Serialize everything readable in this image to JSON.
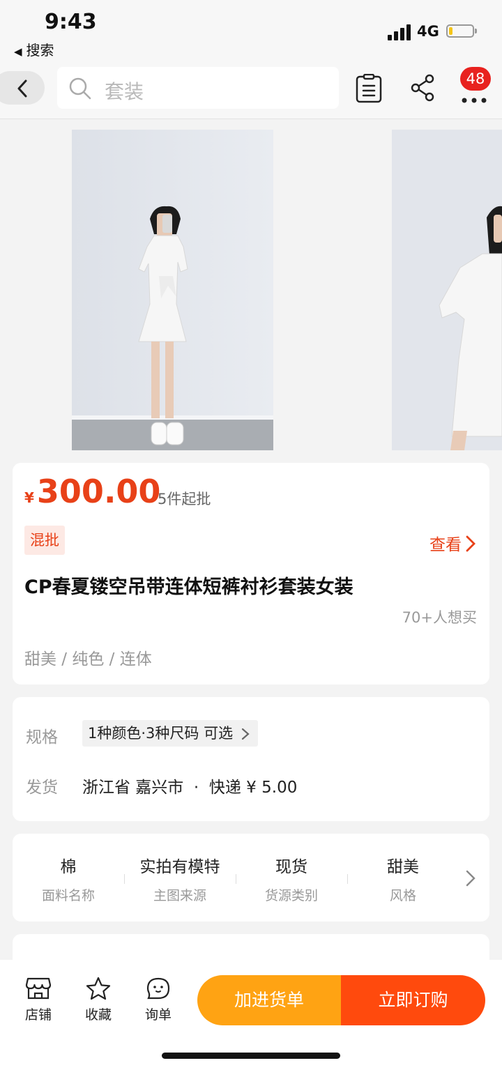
{
  "status_bar": {
    "time": "9:43",
    "back_app": "搜索",
    "network": "4G"
  },
  "nav": {
    "search_placeholder": "套装",
    "cart_count": "48"
  },
  "product": {
    "price_symbol": "¥",
    "price": "300.00",
    "moq": "5件起批",
    "tag": "混批",
    "view_more": "查看",
    "title": "CP春夏镂空吊带连体短裤衬衫套装女装",
    "want_count": "70+人想买",
    "attributes": "甜美 / 纯色 / 连体"
  },
  "spec": {
    "label": "规格",
    "value": "1种颜色·3种尺码 可选",
    "ship_label": "发货",
    "ship_value": "浙江省 嘉兴市  ·  快递 ¥ 5.00"
  },
  "params": [
    {
      "value": "棉",
      "key": "面料名称"
    },
    {
      "value": "实拍有模特",
      "key": "主图来源"
    },
    {
      "value": "现货",
      "key": "货源类别"
    },
    {
      "value": "甜美",
      "key": "风格"
    }
  ],
  "bottom_bar": {
    "shop": "店铺",
    "favorite": "收藏",
    "inquiry": "询单",
    "add_to_list": "加进货单",
    "buy_now": "立即订购"
  },
  "colors": {
    "accent": "#e84118",
    "orange_button": "#ffa313",
    "red_button": "#ff4a0d",
    "badge": "#e8221f"
  }
}
